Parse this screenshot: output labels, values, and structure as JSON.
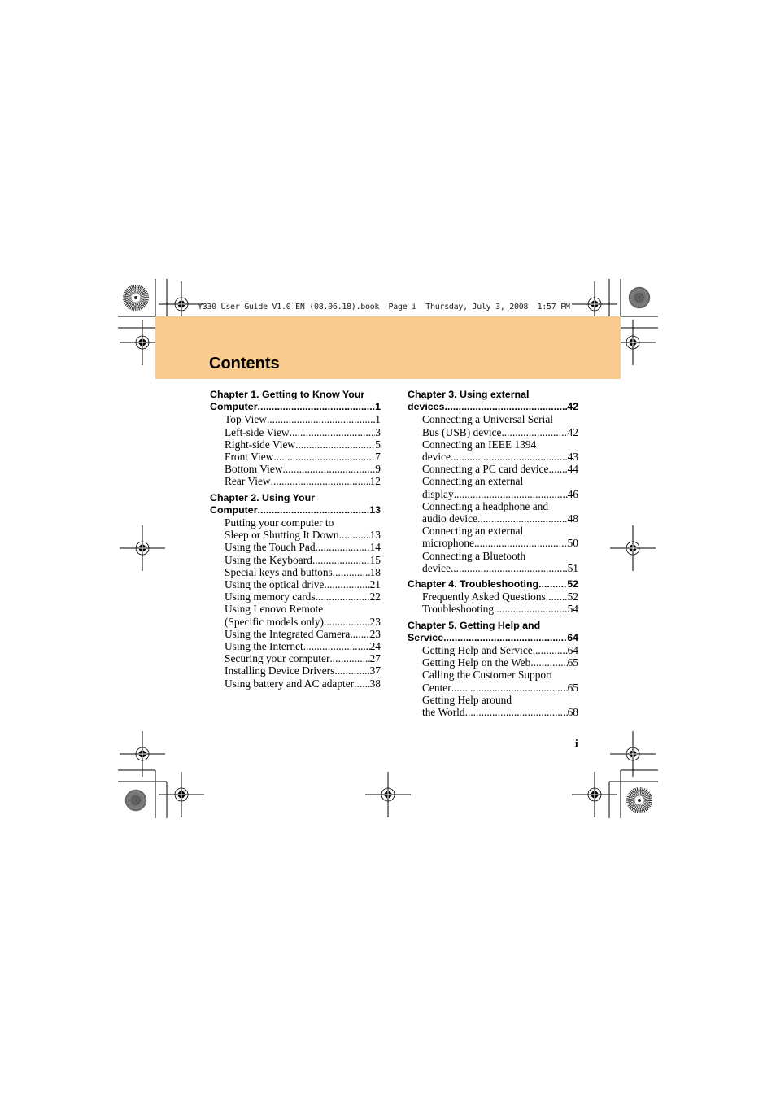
{
  "slug_line": "Y330 User Guide V1.0 EN (08.06.18).book  Page i  Thursday, July 3, 2008  1:57 PM",
  "page_title": "Contents",
  "folio": "i",
  "colors": {
    "band": "#F9CB8F",
    "text": "#000000"
  },
  "columns": [
    {
      "chapters": [
        {
          "title_lines": [
            "Chapter 1. Getting to Know Your"
          ],
          "last_line": "Computer",
          "page": "1",
          "sections": [
            {
              "lines": [
                "Top View"
              ],
              "page": "1"
            },
            {
              "lines": [
                "Left-side View"
              ],
              "page": "3"
            },
            {
              "lines": [
                "Right-side View"
              ],
              "page": "5"
            },
            {
              "lines": [
                "Front View"
              ],
              "page": "7"
            },
            {
              "lines": [
                "Bottom View"
              ],
              "page": "9"
            },
            {
              "lines": [
                "Rear View"
              ],
              "page": "12"
            }
          ]
        },
        {
          "title_lines": [
            "Chapter 2. Using Your"
          ],
          "last_line": "Computer",
          "page": "13",
          "sections": [
            {
              "lines": [
                "Putting your computer to",
                "Sleep or Shutting It Down"
              ],
              "page": "13"
            },
            {
              "lines": [
                "Using the Touch Pad"
              ],
              "page": "14"
            },
            {
              "lines": [
                "Using the Keyboard"
              ],
              "page": "15"
            },
            {
              "lines": [
                "Special keys and buttons"
              ],
              "page": "18"
            },
            {
              "lines": [
                "Using the optical drive"
              ],
              "page": "21"
            },
            {
              "lines": [
                "Using memory cards"
              ],
              "page": "22"
            },
            {
              "lines": [
                "Using Lenovo Remote",
                "(Specific models only)"
              ],
              "page": "23"
            },
            {
              "lines": [
                "Using the Integrated Camera"
              ],
              "page": "23"
            },
            {
              "lines": [
                "Using the Internet"
              ],
              "page": "24"
            },
            {
              "lines": [
                "Securing your computer"
              ],
              "page": "27"
            },
            {
              "lines": [
                "Installing Device Drivers"
              ],
              "page": "37"
            },
            {
              "lines": [
                "Using battery and AC adapter"
              ],
              "page": "38"
            }
          ]
        }
      ]
    },
    {
      "chapters": [
        {
          "title_lines": [
            "Chapter 3. Using external"
          ],
          "last_line": "devices",
          "page": "42",
          "sections": [
            {
              "lines": [
                "Connecting a Universal Serial",
                "Bus (USB) device"
              ],
              "page": "42"
            },
            {
              "lines": [
                "Connecting an IEEE 1394",
                "device"
              ],
              "page": "43"
            },
            {
              "lines": [
                "Connecting a PC card device"
              ],
              "page": "44"
            },
            {
              "lines": [
                "Connecting an external",
                "display"
              ],
              "page": "46"
            },
            {
              "lines": [
                "Connecting a headphone and",
                "audio device"
              ],
              "page": "48"
            },
            {
              "lines": [
                "Connecting an external",
                "microphone"
              ],
              "page": "50"
            },
            {
              "lines": [
                "Connecting a Bluetooth",
                "device"
              ],
              "page": "51"
            }
          ]
        },
        {
          "title_lines": [],
          "last_line": "Chapter 4. Troubleshooting",
          "page": "52",
          "sections": [
            {
              "lines": [
                "Frequently Asked Questions"
              ],
              "page": "52"
            },
            {
              "lines": [
                "Troubleshooting"
              ],
              "page": "54"
            }
          ]
        },
        {
          "title_lines": [
            "Chapter 5. Getting Help and"
          ],
          "last_line": "Service",
          "page": "64",
          "sections": [
            {
              "lines": [
                "Getting Help and Service"
              ],
              "page": "64"
            },
            {
              "lines": [
                "Getting Help on the Web"
              ],
              "page": "65"
            },
            {
              "lines": [
                "Calling the Customer Support",
                "Center"
              ],
              "page": "65"
            },
            {
              "lines": [
                "Getting Help around",
                "the World"
              ],
              "page": "68"
            }
          ]
        }
      ]
    }
  ]
}
